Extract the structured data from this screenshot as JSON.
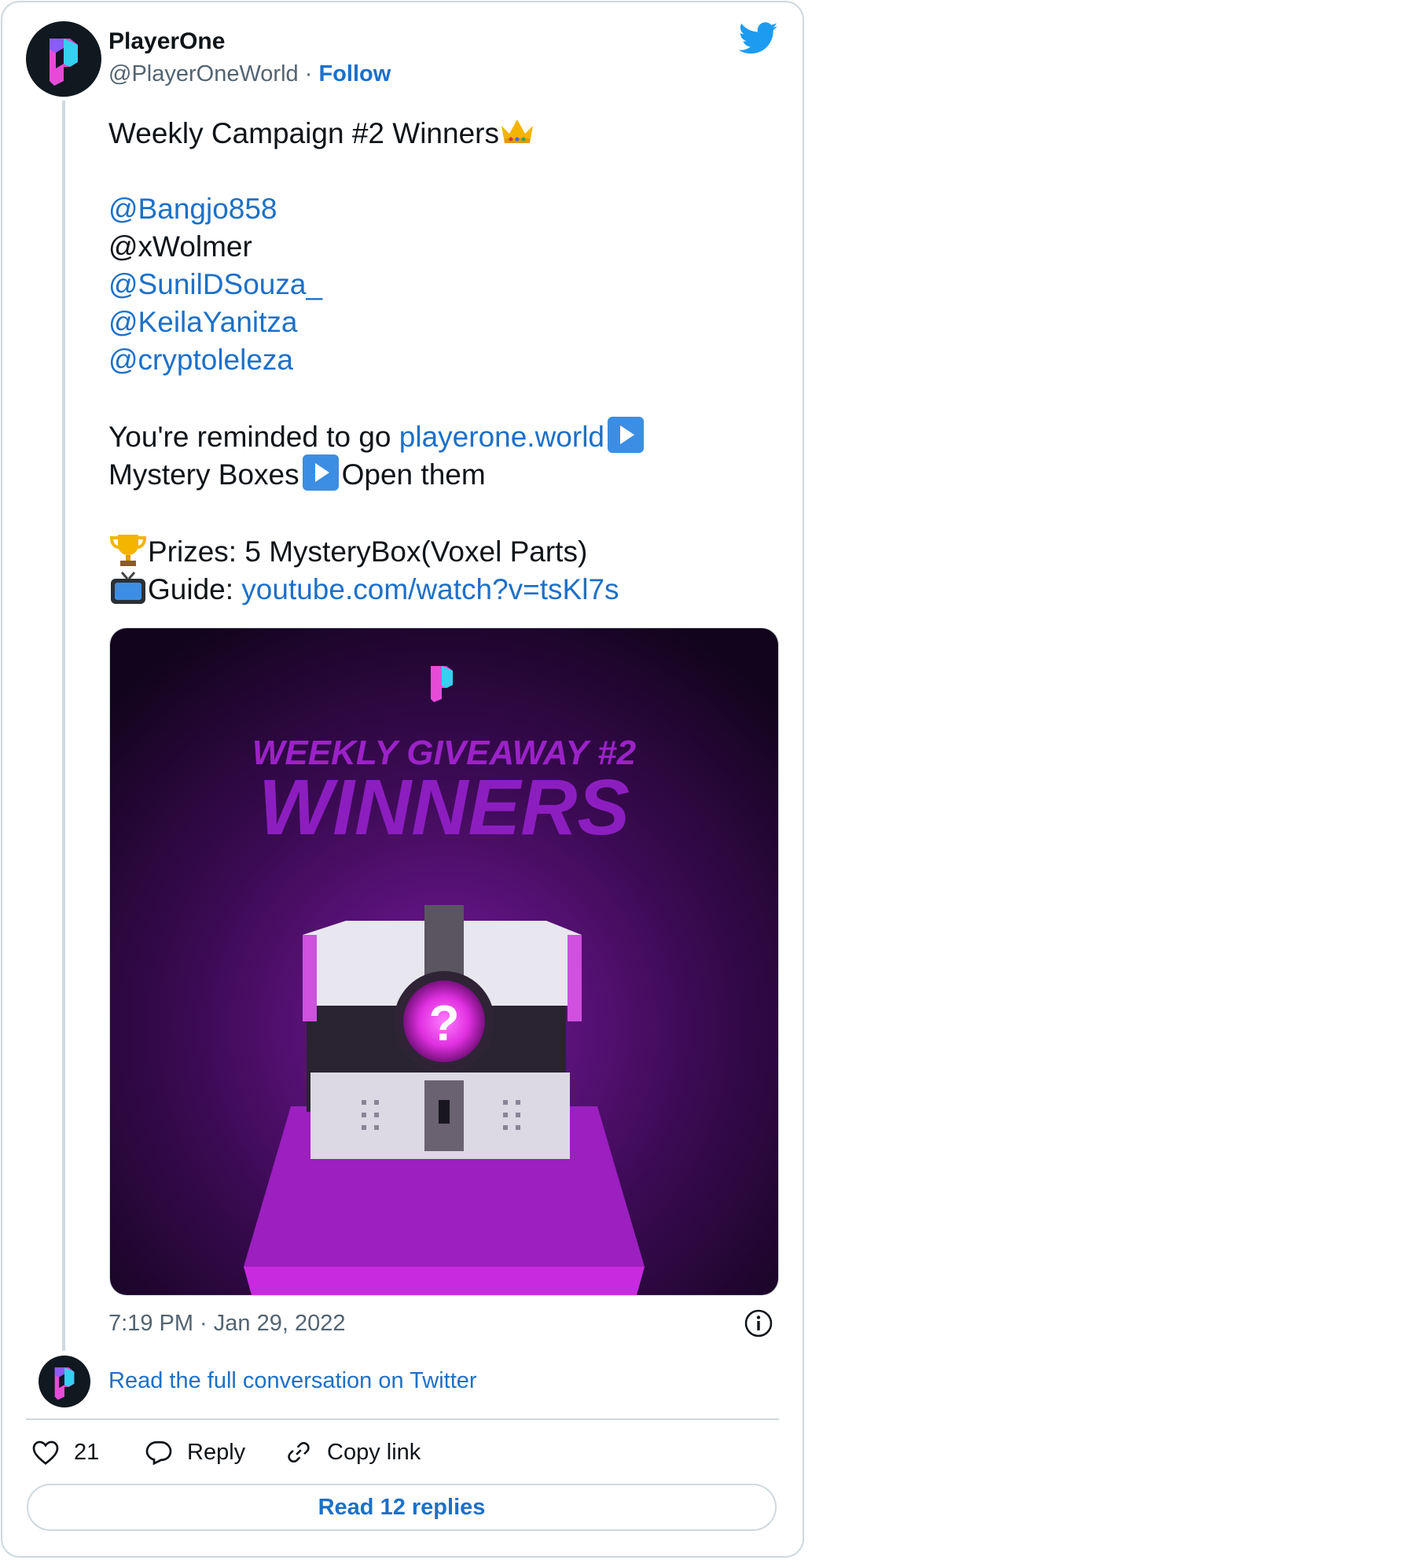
{
  "author": {
    "name": "PlayerOne",
    "handle": "@PlayerOneWorld",
    "separator": "·",
    "follow_label": "Follow"
  },
  "tweet": {
    "line1": "Weekly Campaign #2 Winners",
    "line1_emoji": "crown",
    "mentions": [
      "@Bangjo858",
      "@xWolmer",
      "@SunilDSouza_",
      "@KeilaYanitza",
      "@cryptoleleza"
    ],
    "reminder_prefix": "You're reminded to go ",
    "reminder_link": "playerone.world",
    "reminder_part2": "Mystery Boxes",
    "reminder_part3": "Open them",
    "prizes_emoji": "trophy",
    "prizes_text": "Prizes: 5 MysteryBox(Voxel Parts)",
    "guide_emoji": "television",
    "guide_label": "Guide: ",
    "guide_link": "youtube.com/watch?v=tsKl7s"
  },
  "media": {
    "line1": "WEEKLY GIVEAWAY #2",
    "line2": "WINNERS"
  },
  "timestamp": "7:19 PM · Jan 29, 2022",
  "read_conversation": "Read the full conversation on Twitter",
  "actions": {
    "like_count": "21",
    "reply_label": "Reply",
    "copy_label": "Copy link"
  },
  "read_replies": "Read 12 replies",
  "colors": {
    "link": "#1d70c8",
    "twitter_blue": "#1d9bf0",
    "border": "#cfd9de"
  }
}
